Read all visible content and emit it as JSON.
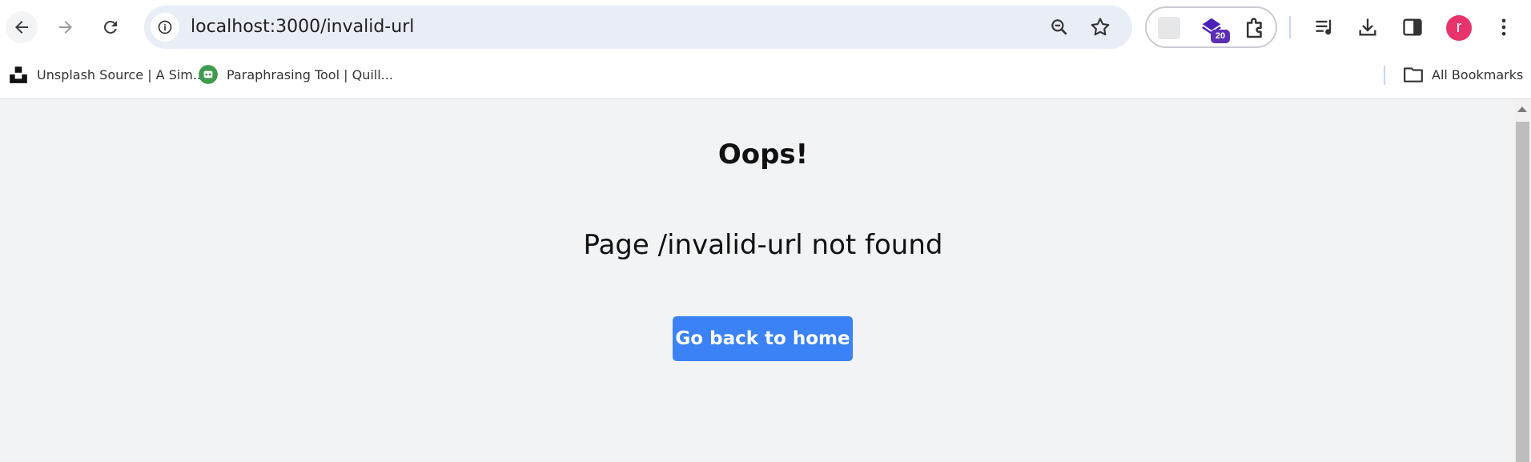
{
  "browser": {
    "url": "localhost:3000/invalid-url",
    "extension_badge": "20",
    "profile_initial": "r"
  },
  "bookmarks_bar": {
    "items": [
      {
        "label": "Unsplash Source | A Sim..."
      },
      {
        "label": "Paraphrasing Tool | Quill..."
      }
    ],
    "all_bookmarks_label": "All Bookmarks"
  },
  "page": {
    "title": "Oops!",
    "message": "Page /invalid-url not found",
    "home_button_label": "Go back to home"
  },
  "colors": {
    "button": "#3b82f6",
    "page_background": "#f2f3f5",
    "avatar": "#e8336c",
    "badge": "#5b2fb3"
  },
  "icons": [
    "back-arrow-icon",
    "forward-arrow-icon",
    "reload-icon",
    "site-info-icon",
    "zoom-icon",
    "bookmark-star-icon",
    "extension-icon",
    "puzzle-icon",
    "media-queue-icon",
    "download-icon",
    "side-panel-icon",
    "more-menu-icon",
    "folder-icon"
  ]
}
